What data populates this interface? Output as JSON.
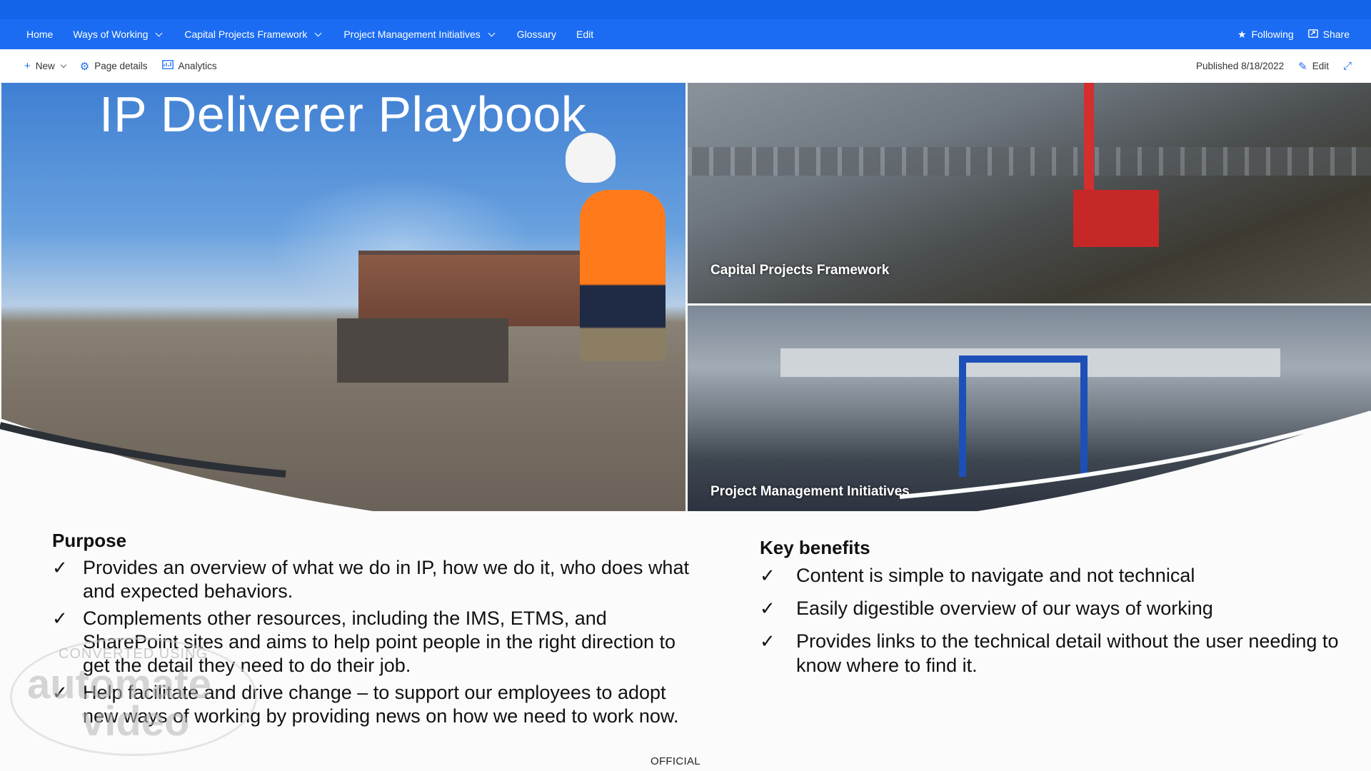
{
  "nav": {
    "items": [
      {
        "label": "Home",
        "dropdown": false
      },
      {
        "label": "Ways of Working",
        "dropdown": true
      },
      {
        "label": "Capital Projects Framework",
        "dropdown": true
      },
      {
        "label": "Project Management Initiatives",
        "dropdown": true
      },
      {
        "label": "Glossary",
        "dropdown": false
      },
      {
        "label": "Edit",
        "dropdown": false
      }
    ],
    "following_label": "Following",
    "share_label": "Share"
  },
  "command_bar": {
    "new_label": "New",
    "page_details_label": "Page details",
    "analytics_label": "Analytics",
    "published_label": "Published 8/18/2022",
    "edit_label": "Edit"
  },
  "hero": {
    "title": "IP Deliverer Playbook",
    "panel_cpf_label": "Capital Projects Framework",
    "panel_pmi_label": "Project Management Initiatives"
  },
  "purpose": {
    "title": "Purpose",
    "bullets": [
      "Provides an overview of what we do in IP, how we do it, who does what and expected behaviors.",
      "Complements other resources, including the IMS, ETMS, and SharePoint sites and aims to help point people in the right direction to get the detail they need to do their job.",
      "Help facilitate and drive change – to support our employees to adopt new ways of working by providing news on how we need to work now."
    ]
  },
  "benefits": {
    "title": "Key benefits",
    "bullets": [
      "Content is simple to navigate and not technical",
      "Easily digestible overview of our ways of working",
      "Provides links to the technical detail without the user needing to know where to find it."
    ]
  },
  "footer": {
    "classification": "OFFICIAL"
  },
  "watermark": {
    "line1": "CONVERTED USING",
    "line2": "automate",
    "line3": "video"
  },
  "icons": {
    "check": "✓",
    "plus": "+",
    "gear": "⚙",
    "star": "★",
    "pencil": "✎",
    "expand": "⤢"
  },
  "colors": {
    "top_bar": "#1464ea",
    "nav_bar": "#1b6cf2",
    "accent": "#1b6cf2"
  }
}
